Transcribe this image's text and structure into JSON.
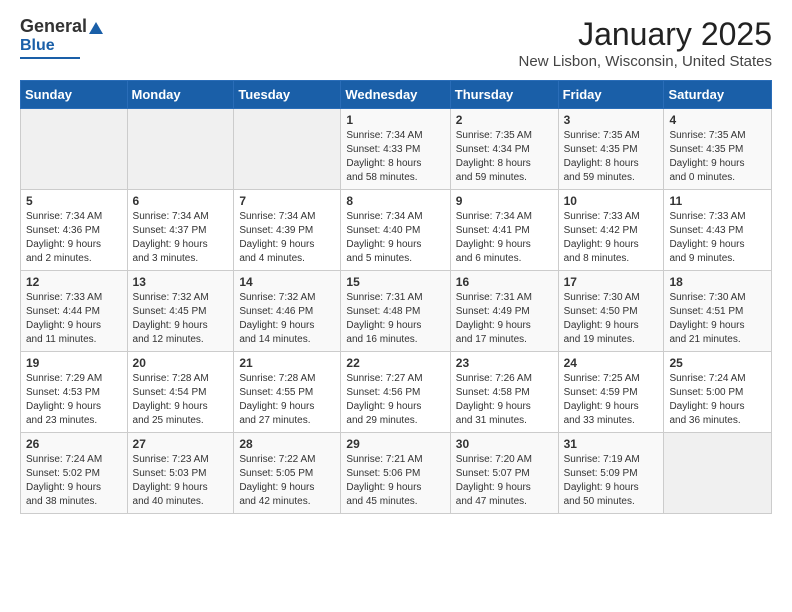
{
  "header": {
    "logo_general": "General",
    "logo_blue": "Blue",
    "month_title": "January 2025",
    "location": "New Lisbon, Wisconsin, United States"
  },
  "weekdays": [
    "Sunday",
    "Monday",
    "Tuesday",
    "Wednesday",
    "Thursday",
    "Friday",
    "Saturday"
  ],
  "weeks": [
    [
      {
        "day": "",
        "info": ""
      },
      {
        "day": "",
        "info": ""
      },
      {
        "day": "",
        "info": ""
      },
      {
        "day": "1",
        "info": "Sunrise: 7:34 AM\nSunset: 4:33 PM\nDaylight: 8 hours\nand 58 minutes."
      },
      {
        "day": "2",
        "info": "Sunrise: 7:35 AM\nSunset: 4:34 PM\nDaylight: 8 hours\nand 59 minutes."
      },
      {
        "day": "3",
        "info": "Sunrise: 7:35 AM\nSunset: 4:35 PM\nDaylight: 8 hours\nand 59 minutes."
      },
      {
        "day": "4",
        "info": "Sunrise: 7:35 AM\nSunset: 4:35 PM\nDaylight: 9 hours\nand 0 minutes."
      }
    ],
    [
      {
        "day": "5",
        "info": "Sunrise: 7:34 AM\nSunset: 4:36 PM\nDaylight: 9 hours\nand 2 minutes."
      },
      {
        "day": "6",
        "info": "Sunrise: 7:34 AM\nSunset: 4:37 PM\nDaylight: 9 hours\nand 3 minutes."
      },
      {
        "day": "7",
        "info": "Sunrise: 7:34 AM\nSunset: 4:39 PM\nDaylight: 9 hours\nand 4 minutes."
      },
      {
        "day": "8",
        "info": "Sunrise: 7:34 AM\nSunset: 4:40 PM\nDaylight: 9 hours\nand 5 minutes."
      },
      {
        "day": "9",
        "info": "Sunrise: 7:34 AM\nSunset: 4:41 PM\nDaylight: 9 hours\nand 6 minutes."
      },
      {
        "day": "10",
        "info": "Sunrise: 7:33 AM\nSunset: 4:42 PM\nDaylight: 9 hours\nand 8 minutes."
      },
      {
        "day": "11",
        "info": "Sunrise: 7:33 AM\nSunset: 4:43 PM\nDaylight: 9 hours\nand 9 minutes."
      }
    ],
    [
      {
        "day": "12",
        "info": "Sunrise: 7:33 AM\nSunset: 4:44 PM\nDaylight: 9 hours\nand 11 minutes."
      },
      {
        "day": "13",
        "info": "Sunrise: 7:32 AM\nSunset: 4:45 PM\nDaylight: 9 hours\nand 12 minutes."
      },
      {
        "day": "14",
        "info": "Sunrise: 7:32 AM\nSunset: 4:46 PM\nDaylight: 9 hours\nand 14 minutes."
      },
      {
        "day": "15",
        "info": "Sunrise: 7:31 AM\nSunset: 4:48 PM\nDaylight: 9 hours\nand 16 minutes."
      },
      {
        "day": "16",
        "info": "Sunrise: 7:31 AM\nSunset: 4:49 PM\nDaylight: 9 hours\nand 17 minutes."
      },
      {
        "day": "17",
        "info": "Sunrise: 7:30 AM\nSunset: 4:50 PM\nDaylight: 9 hours\nand 19 minutes."
      },
      {
        "day": "18",
        "info": "Sunrise: 7:30 AM\nSunset: 4:51 PM\nDaylight: 9 hours\nand 21 minutes."
      }
    ],
    [
      {
        "day": "19",
        "info": "Sunrise: 7:29 AM\nSunset: 4:53 PM\nDaylight: 9 hours\nand 23 minutes."
      },
      {
        "day": "20",
        "info": "Sunrise: 7:28 AM\nSunset: 4:54 PM\nDaylight: 9 hours\nand 25 minutes."
      },
      {
        "day": "21",
        "info": "Sunrise: 7:28 AM\nSunset: 4:55 PM\nDaylight: 9 hours\nand 27 minutes."
      },
      {
        "day": "22",
        "info": "Sunrise: 7:27 AM\nSunset: 4:56 PM\nDaylight: 9 hours\nand 29 minutes."
      },
      {
        "day": "23",
        "info": "Sunrise: 7:26 AM\nSunset: 4:58 PM\nDaylight: 9 hours\nand 31 minutes."
      },
      {
        "day": "24",
        "info": "Sunrise: 7:25 AM\nSunset: 4:59 PM\nDaylight: 9 hours\nand 33 minutes."
      },
      {
        "day": "25",
        "info": "Sunrise: 7:24 AM\nSunset: 5:00 PM\nDaylight: 9 hours\nand 36 minutes."
      }
    ],
    [
      {
        "day": "26",
        "info": "Sunrise: 7:24 AM\nSunset: 5:02 PM\nDaylight: 9 hours\nand 38 minutes."
      },
      {
        "day": "27",
        "info": "Sunrise: 7:23 AM\nSunset: 5:03 PM\nDaylight: 9 hours\nand 40 minutes."
      },
      {
        "day": "28",
        "info": "Sunrise: 7:22 AM\nSunset: 5:05 PM\nDaylight: 9 hours\nand 42 minutes."
      },
      {
        "day": "29",
        "info": "Sunrise: 7:21 AM\nSunset: 5:06 PM\nDaylight: 9 hours\nand 45 minutes."
      },
      {
        "day": "30",
        "info": "Sunrise: 7:20 AM\nSunset: 5:07 PM\nDaylight: 9 hours\nand 47 minutes."
      },
      {
        "day": "31",
        "info": "Sunrise: 7:19 AM\nSunset: 5:09 PM\nDaylight: 9 hours\nand 50 minutes."
      },
      {
        "day": "",
        "info": ""
      }
    ]
  ]
}
